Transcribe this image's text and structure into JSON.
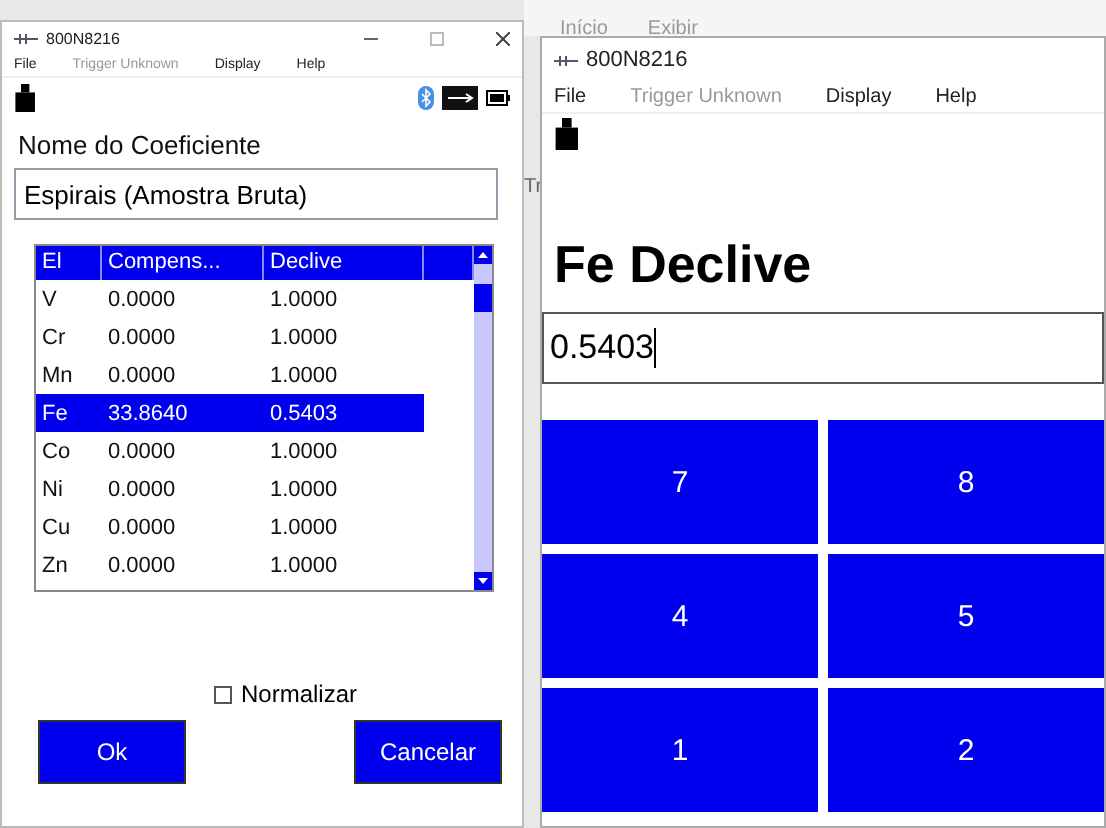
{
  "background_tabs": [
    {
      "label": "Início"
    },
    {
      "label": "Exibir"
    }
  ],
  "background_side_text": "Tr",
  "coefficient_window": {
    "title": "800N8216",
    "menu": [
      {
        "label": "File",
        "disabled": false
      },
      {
        "label": "Trigger Unknown",
        "disabled": true
      },
      {
        "label": "Display",
        "disabled": false
      },
      {
        "label": "Help",
        "disabled": false
      }
    ],
    "name_label": "Nome do Coeficiente",
    "name_value": "Espirais (Amostra Bruta)",
    "table": {
      "columns": [
        "El",
        "Compens...",
        "Declive"
      ],
      "rows": [
        {
          "cells": [
            "V",
            "0.0000",
            "1.0000"
          ],
          "selected": false
        },
        {
          "cells": [
            "Cr",
            "0.0000",
            "1.0000"
          ],
          "selected": false
        },
        {
          "cells": [
            "Mn",
            "0.0000",
            "1.0000"
          ],
          "selected": false
        },
        {
          "cells": [
            "Fe",
            "33.8640",
            "0.5403"
          ],
          "selected": true
        },
        {
          "cells": [
            "Co",
            "0.0000",
            "1.0000"
          ],
          "selected": false
        },
        {
          "cells": [
            "Ni",
            "0.0000",
            "1.0000"
          ],
          "selected": false
        },
        {
          "cells": [
            "Cu",
            "0.0000",
            "1.0000"
          ],
          "selected": false
        },
        {
          "cells": [
            "Zn",
            "0.0000",
            "1.0000"
          ],
          "selected": false
        }
      ]
    },
    "normalize": {
      "label": "Normalizar",
      "checked": false
    },
    "buttons": [
      "Ok",
      "Cancelar"
    ]
  },
  "entry_window": {
    "title": "800N8216",
    "menu": [
      {
        "label": "File",
        "disabled": false
      },
      {
        "label": "Trigger Unknown",
        "disabled": true
      },
      {
        "label": "Display",
        "disabled": false
      },
      {
        "label": "Help",
        "disabled": false
      }
    ],
    "heading": "Fe Declive",
    "value": "0.5403",
    "keys": [
      "7",
      "8",
      "4",
      "5",
      "1",
      "2"
    ]
  }
}
